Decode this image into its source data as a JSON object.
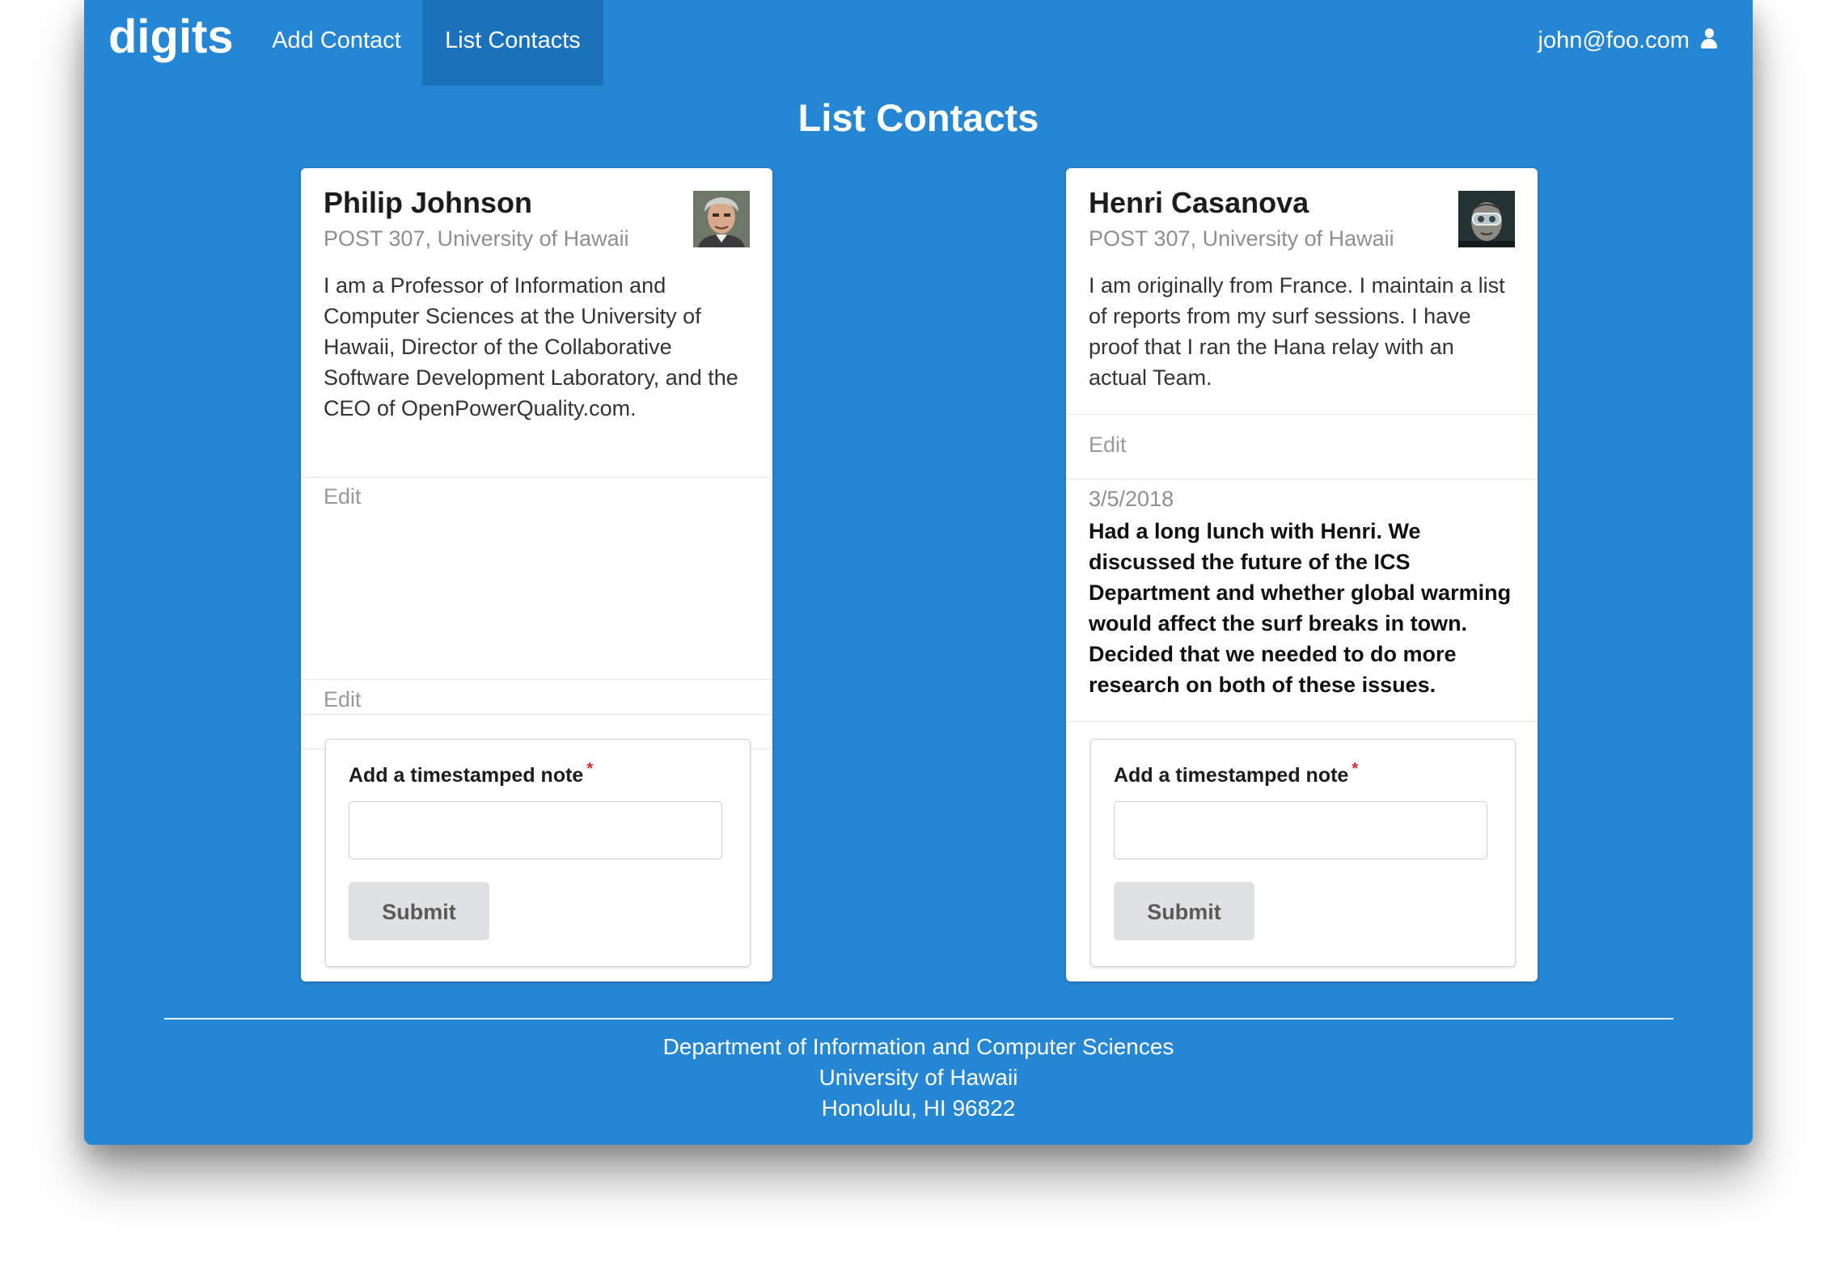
{
  "nav": {
    "brand": "digits",
    "add_contact": "Add Contact",
    "list_contacts": "List Contacts",
    "user_email": "john@foo.com",
    "user_icon": "user-icon"
  },
  "page": {
    "title": "List Contacts"
  },
  "contacts": [
    {
      "name": "Philip Johnson",
      "address": "POST 307, University of Hawaii",
      "description": "I am a Professor of Information and Computer Sciences at the University of Hawaii, Director of the Collaborative Software Development Laboratory, and the CEO of OpenPowerQuality.com.",
      "edit_label": "Edit",
      "note_label": "Add a timestamped note",
      "required_mark": "*",
      "note_value": "",
      "submit_label": "Submit"
    },
    {
      "name": "Henri Casanova",
      "address": "POST 307, University of Hawaii",
      "description": "I am originally from France. I maintain a list of reports from my surf sessions. I have proof that I ran the Hana relay with an actual Team.",
      "edit_label": "Edit",
      "notes": [
        {
          "date": "3/5/2018",
          "text": "Had a long lunch with Henri. We discussed the future of the ICS Department and whether global warming would affect the surf breaks in town. Decided that we needed to do more research on both of these issues."
        }
      ],
      "note_label": "Add a timestamped note",
      "required_mark": "*",
      "note_value": "",
      "submit_label": "Submit"
    }
  ],
  "footer": {
    "line1": "Department of Information and Computer Sciences",
    "line2": "University of Hawaii",
    "line3": "Honolulu, HI 96822"
  },
  "colors": {
    "background": "#2586d4",
    "active_nav": "#1a72bb",
    "card": "#ffffff",
    "button": "#e0e1e2",
    "required": "#db2828"
  }
}
